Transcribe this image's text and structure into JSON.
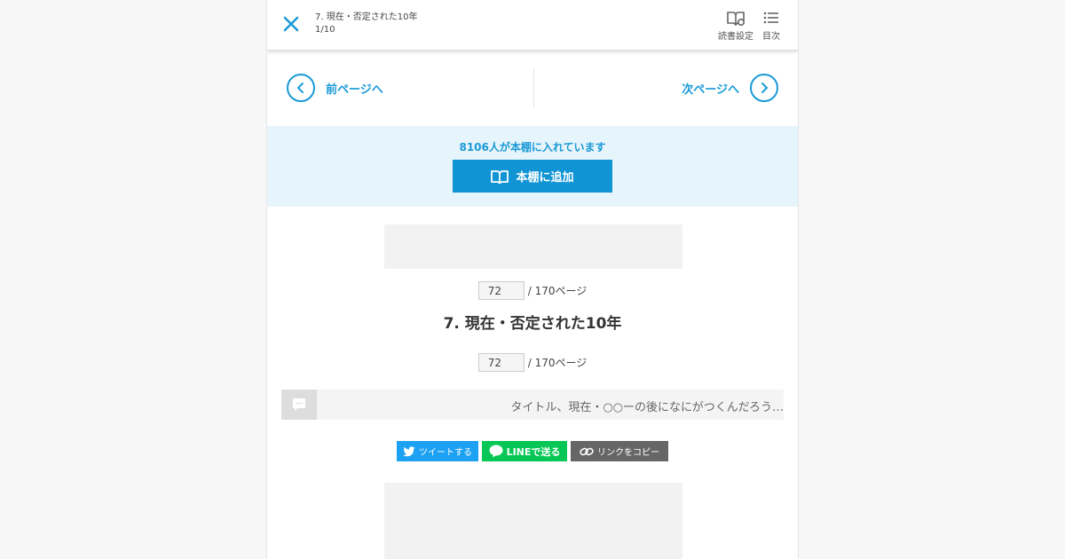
{
  "header": {
    "chapter_title": "7. 現在・否定された10年",
    "progress": "1/10",
    "reading_settings_label": "読書設定",
    "toc_label": "目次"
  },
  "pager": {
    "prev_label": "前ページへ",
    "next_label": "次ページへ"
  },
  "shelf": {
    "count_text": "8106人が本棚に入れています",
    "add_label": "本棚に追加"
  },
  "page_nav": {
    "current": "72",
    "total_text": "/ 170ページ"
  },
  "chapter": {
    "title": "7. 現在・否定された10年"
  },
  "comment": {
    "text": "タイトル、現在・○○ーの後になにがつくんだろう…"
  },
  "share": {
    "tweet_label": "ツイートする",
    "line_label": "LINEで送る",
    "copy_label": "リンクをコピー"
  },
  "colors": {
    "accent": "#1a9ad6",
    "button_blue": "#1194d4",
    "twitter": "#1da1f2",
    "line": "#06c755"
  }
}
